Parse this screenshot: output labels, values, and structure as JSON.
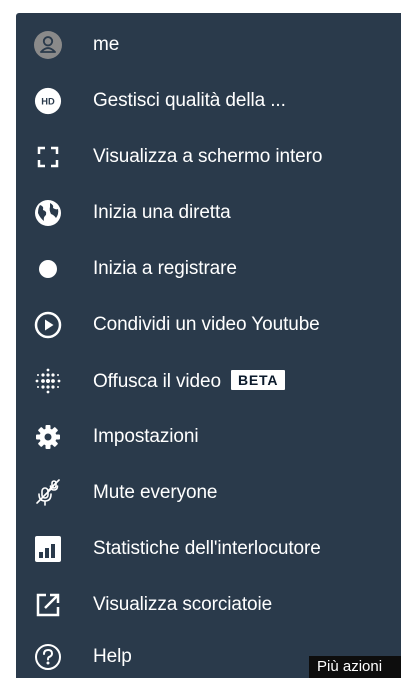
{
  "menu": {
    "items": [
      {
        "label": "me",
        "icon": "avatar"
      },
      {
        "label": "Gestisci qualità della ...",
        "icon": "hd-icon",
        "icon_text": "HD"
      },
      {
        "label": "Visualizza a schermo intero",
        "icon": "fullscreen-icon"
      },
      {
        "label": "Inizia una diretta",
        "icon": "globe-icon"
      },
      {
        "label": "Inizia a registrare",
        "icon": "record-icon"
      },
      {
        "label": "Condividi un video Youtube",
        "icon": "play-circle-icon"
      },
      {
        "label": "Offusca il video",
        "icon": "blur-icon",
        "badge": "BETA"
      },
      {
        "label": "Impostazioni",
        "icon": "gear-icon"
      },
      {
        "label": "Mute everyone",
        "icon": "mic-muted-icon"
      },
      {
        "label": "Statistiche dell'interlocutore",
        "icon": "bar-chart-icon"
      },
      {
        "label": "Visualizza scorciatoie",
        "icon": "external-link-icon"
      },
      {
        "label": "Help",
        "icon": "help-icon"
      }
    ]
  },
  "tooltip": {
    "label": "Più azioni"
  },
  "colors": {
    "menu_background": "#2a3a4b",
    "text": "#ffffff",
    "avatar_gray": "#8a8a8a"
  }
}
